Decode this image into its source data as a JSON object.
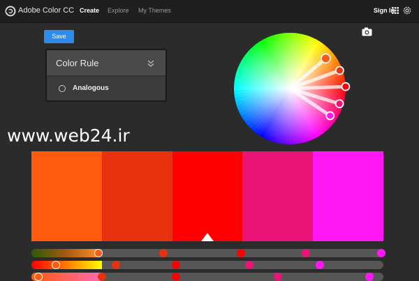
{
  "header": {
    "app_title": "Adobe Color CC",
    "logo_icon": "adobe-color-logo-icon",
    "nav": [
      {
        "label": "Create",
        "active": true
      },
      {
        "label": "Explore",
        "active": false
      },
      {
        "label": "My Themes",
        "active": false
      }
    ],
    "signin_label": "Sign In",
    "apps_icon": "grid-icon",
    "settings_icon": "gear-icon"
  },
  "toolbar": {
    "save_label": "Save"
  },
  "color_rule": {
    "title": "Color Rule",
    "selected_rule": "Analogous"
  },
  "watermark": "www.web24.ir",
  "camera_icon": "camera-icon",
  "colors": {
    "accent": "#2d8ceb",
    "background": "#2b2b2b"
  },
  "swatches": [
    "#ff5a0d",
    "#e8310f",
    "#ff0000",
    "#eb1377",
    "#ff17f5"
  ],
  "base_swatch_index": 2,
  "sliders": [
    {
      "gradient": "linear-gradient(to right, #2c5a0a, #a05a10, #ff8a2a)",
      "fill_fraction": 0.19,
      "knobs": [
        {
          "value": 0.19,
          "color": "#ff5a0d",
          "active": true
        },
        {
          "value": 0.375,
          "color": "#e8310f",
          "active": false
        },
        {
          "value": 0.595,
          "color": "#ff0000",
          "active": false
        },
        {
          "value": 0.78,
          "color": "#eb1377",
          "active": false
        },
        {
          "value": 0.995,
          "color": "#ff17f5",
          "active": false
        }
      ]
    },
    {
      "gradient": "linear-gradient(to right, #ff0000, #ff7a00, #ffff00)",
      "fill_fraction": 0.2,
      "knobs": [
        {
          "value": 0.07,
          "color": "#ff5a0d",
          "active": true
        },
        {
          "value": 0.24,
          "color": "#e8310f",
          "active": false
        },
        {
          "value": 0.41,
          "color": "#ff0000",
          "active": false
        },
        {
          "value": 0.62,
          "color": "#eb1377",
          "active": false
        },
        {
          "value": 0.82,
          "color": "#ff17f5",
          "active": false
        }
      ]
    },
    {
      "gradient": "linear-gradient(to right, #ff5a0d, #ff6ab0)",
      "fill_fraction": 0.2,
      "knobs": [
        {
          "value": 0.02,
          "color": "#ff5a0d",
          "active": true
        },
        {
          "value": 0.2,
          "color": "#e8310f",
          "active": false
        },
        {
          "value": 0.41,
          "color": "#ff0000",
          "active": false
        },
        {
          "value": 0.7,
          "color": "#eb1377",
          "active": false
        },
        {
          "value": 0.96,
          "color": "#ff17f5",
          "active": false
        }
      ]
    }
  ],
  "wheel": {
    "handles": [
      {
        "color": "#ff5a0d",
        "angle_deg": -40,
        "radius": 0.84,
        "active": true
      },
      {
        "color": "#e8310f",
        "angle_deg": -20,
        "radius": 0.95
      },
      {
        "color": "#ff0000",
        "angle_deg": -2,
        "radius": 1.0
      },
      {
        "color": "#eb1377",
        "angle_deg": 17,
        "radius": 0.93
      },
      {
        "color": "#ff17f5",
        "angle_deg": 34,
        "radius": 0.87
      }
    ]
  }
}
